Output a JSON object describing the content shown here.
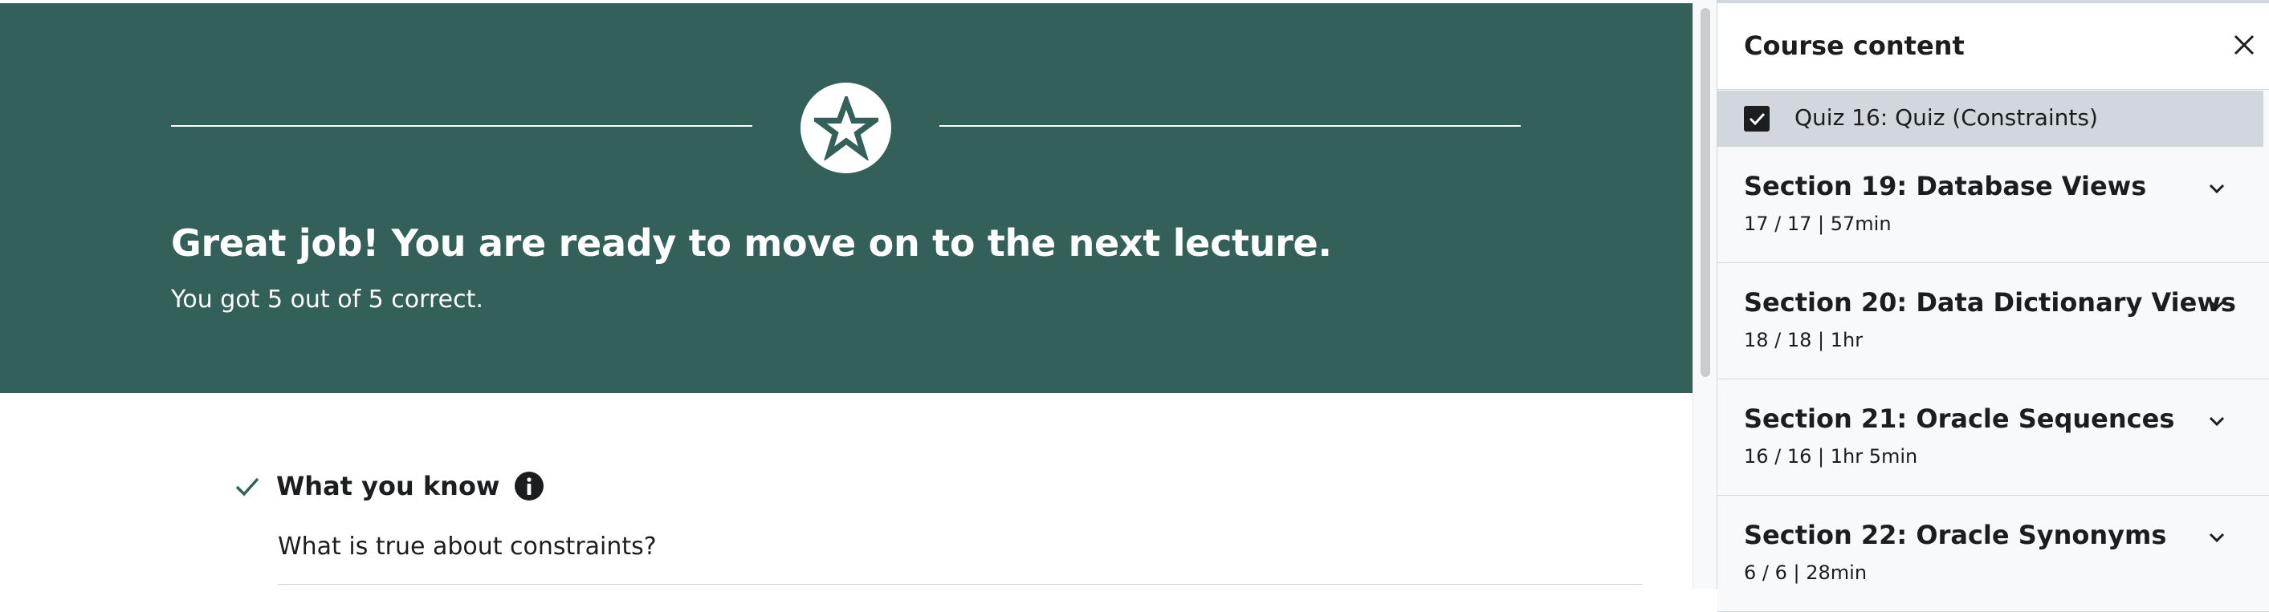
{
  "banner": {
    "title": "Great job! You are ready to move on to the next lecture.",
    "subtitle": "You got 5 out of 5 correct.",
    "color": "#34605a"
  },
  "results": {
    "heading": "What you know",
    "question": "What is true about constraints?"
  },
  "sidebar": {
    "title": "Course content",
    "current_item": {
      "label": "Quiz 16: Quiz (Constraints)",
      "completed": true
    },
    "sections": [
      {
        "title": "Section 19: Database Views",
        "meta": "17 / 17 | 57min"
      },
      {
        "title": "Section 20: Data Dictionary Views",
        "meta": "18 / 18 | 1hr"
      },
      {
        "title": "Section 21: Oracle Sequences",
        "meta": "16 / 16 | 1hr 5min"
      },
      {
        "title": "Section 22: Oracle Synonyms",
        "meta": "6 / 6 | 28min"
      }
    ]
  },
  "icons": {
    "badge": "star-icon",
    "success": "check-icon",
    "info": "info-icon",
    "close": "close-icon",
    "expand": "chevron-down-icon"
  }
}
